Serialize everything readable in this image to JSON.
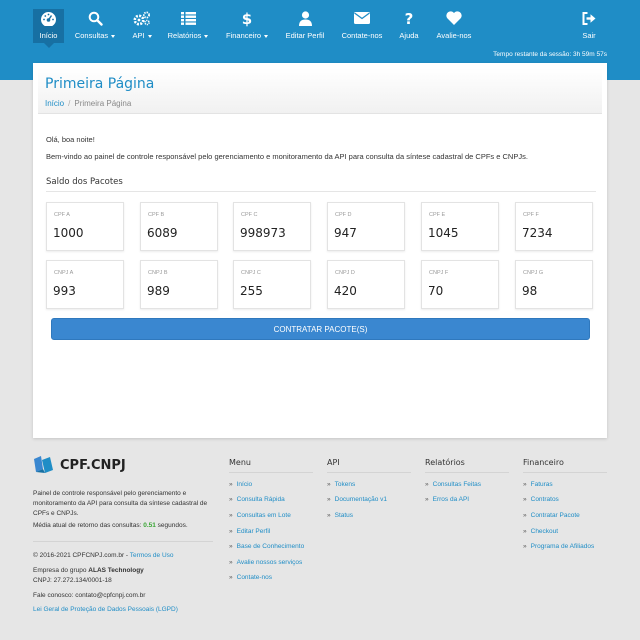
{
  "nav": {
    "items": [
      {
        "label": "Início",
        "icon": "dashboard-icon"
      },
      {
        "label": "Consultas",
        "icon": "search-icon"
      },
      {
        "label": "API",
        "icon": "cogs-icon"
      },
      {
        "label": "Relatórios",
        "icon": "list-icon"
      },
      {
        "label": "Financeiro",
        "icon": "dollar-icon"
      },
      {
        "label": "Editar Perfil",
        "icon": "user-icon"
      },
      {
        "label": "Contate-nos",
        "icon": "envelope-icon"
      },
      {
        "label": "Ajuda",
        "icon": "question-icon"
      },
      {
        "label": "Avalie-nos",
        "icon": "heart-icon"
      },
      {
        "label": "Sair",
        "icon": "sign-out-icon"
      }
    ],
    "session": "Tempo restante da sessão: 3h 59m 57s"
  },
  "page": {
    "title": "Primeira Página",
    "breadcrumb": {
      "home": "Início",
      "sep": "/",
      "current": "Primeira Página"
    },
    "greeting": "Olá, boa noite!",
    "welcome": "Bem-vindo ao painel de controle responsável pelo gerenciamento e monitoramento da API para consulta da síntese cadastral de CPFs e CNPJs.",
    "section_title": "Saldo dos Pacotes",
    "cards": [
      {
        "label": "CPF A",
        "value": "1000"
      },
      {
        "label": "CPF B",
        "value": "6089"
      },
      {
        "label": "CPF C",
        "value": "998973"
      },
      {
        "label": "CPF D",
        "value": "947"
      },
      {
        "label": "CPF E",
        "value": "1045"
      },
      {
        "label": "CPF F",
        "value": "7234"
      },
      {
        "label": "CNPJ A",
        "value": "993"
      },
      {
        "label": "CNPJ B",
        "value": "989"
      },
      {
        "label": "CNPJ C",
        "value": "255"
      },
      {
        "label": "CNPJ D",
        "value": "420"
      },
      {
        "label": "CNPJ F",
        "value": "70"
      },
      {
        "label": "CNPJ G",
        "value": "98"
      }
    ],
    "cta": "CONTRATAR PACOTE(S)"
  },
  "footer": {
    "logo": "CPF.CNPJ",
    "description": "Painel de controle responsável pelo gerenciamento e monitoramento da API para consulta da síntese cadastral de CPFs e CNPJs.",
    "avg_prefix": "Média atual de retorno das consultas: ",
    "avg_value": "0.51",
    "avg_suffix": " segundos.",
    "copyright": "© 2016-2021 CPFCNPJ.com.br - ",
    "terms": "Termos de Uso",
    "group_prefix": "Empresa do grupo ",
    "group_name": "ALAS Technology",
    "cnpj": "CNPJ: 27.272.134/0001-18",
    "contact": "Fale conosco: contato@cpfcnpj.com.br",
    "lgpd": "Lei Geral de Proteção de Dados Pessoais (LGPD)",
    "chevron": "»",
    "columns": [
      {
        "title": "Menu",
        "links": [
          "Início",
          "Consulta Rápida",
          "Consultas em Lote",
          "Editar Perfil",
          "Base de Conhecimento",
          "Avalie nossos serviços",
          "Contate-nos"
        ]
      },
      {
        "title": "API",
        "links": [
          "Tokens",
          "Documentação v1",
          "Status"
        ]
      },
      {
        "title": "Relatórios",
        "links": [
          "Consultas Feitas",
          "Erros da API"
        ]
      },
      {
        "title": "Financeiro",
        "links": [
          "Faturas",
          "Contratos",
          "Contratar Pacote",
          "Checkout",
          "Programa de Afiliados"
        ]
      }
    ]
  },
  "colors": {
    "primary": "#1f8dc6",
    "nav_active": "#1770a3",
    "button": "#3a87d0",
    "success": "#3aa535"
  }
}
